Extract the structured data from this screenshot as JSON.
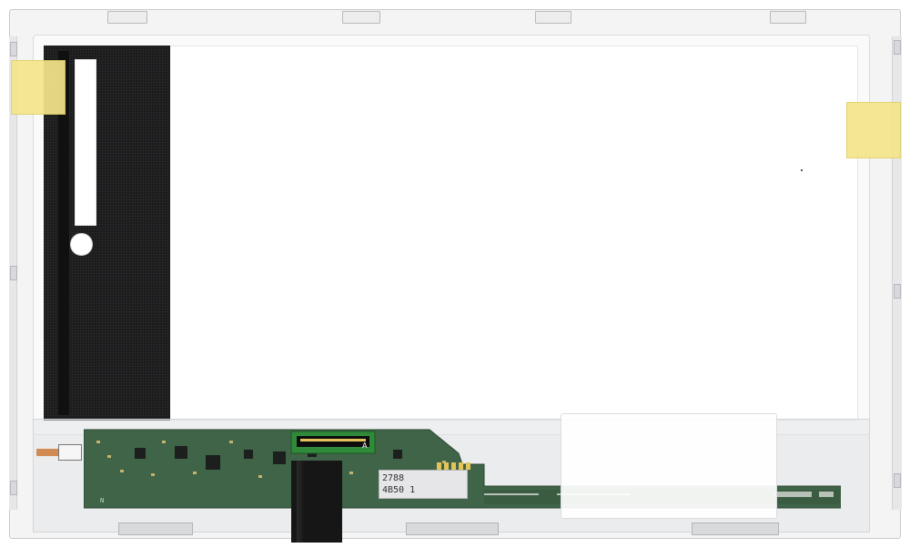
{
  "image": {
    "subject": "laptop-lcd-panel",
    "colors": {
      "frame": "#f4f4f5",
      "backing_sheet": "#1b1b1c",
      "pcb_green": "#3f6448",
      "tape_yellow": "#f4e58b",
      "connector_green": "#2f8b3a",
      "flex_cable": "#161617"
    }
  },
  "labels": {
    "serial_line_1": "2788",
    "serial_line_2": "4B50 1",
    "pcb_marking": "N",
    "connector_marking": "A"
  }
}
